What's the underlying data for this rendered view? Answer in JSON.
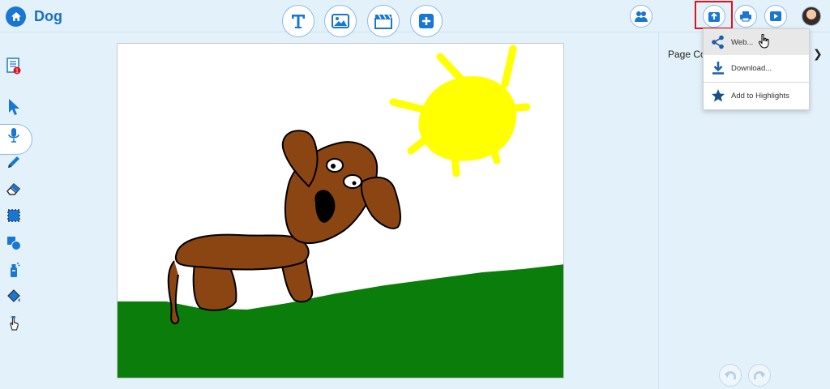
{
  "app": {
    "title": "Dog"
  },
  "toolbar": {
    "text_tool": "text-tool",
    "image_tool": "image-tool",
    "video_tool": "video-tool",
    "add_tool": "add-page-tool"
  },
  "right_panel": {
    "label": "Page Col"
  },
  "share_menu": {
    "items": [
      {
        "label": "Web...",
        "icon": "share-icon"
      },
      {
        "label": "Download...",
        "icon": "download-icon"
      },
      {
        "label": "Add to Highlights",
        "icon": "star-icon"
      }
    ]
  },
  "colors": {
    "accent": "#1877d4",
    "highlight": "#e0121b",
    "grass": "#0a7d0a",
    "sun": "#ffff00",
    "dog": "#8b4513"
  }
}
